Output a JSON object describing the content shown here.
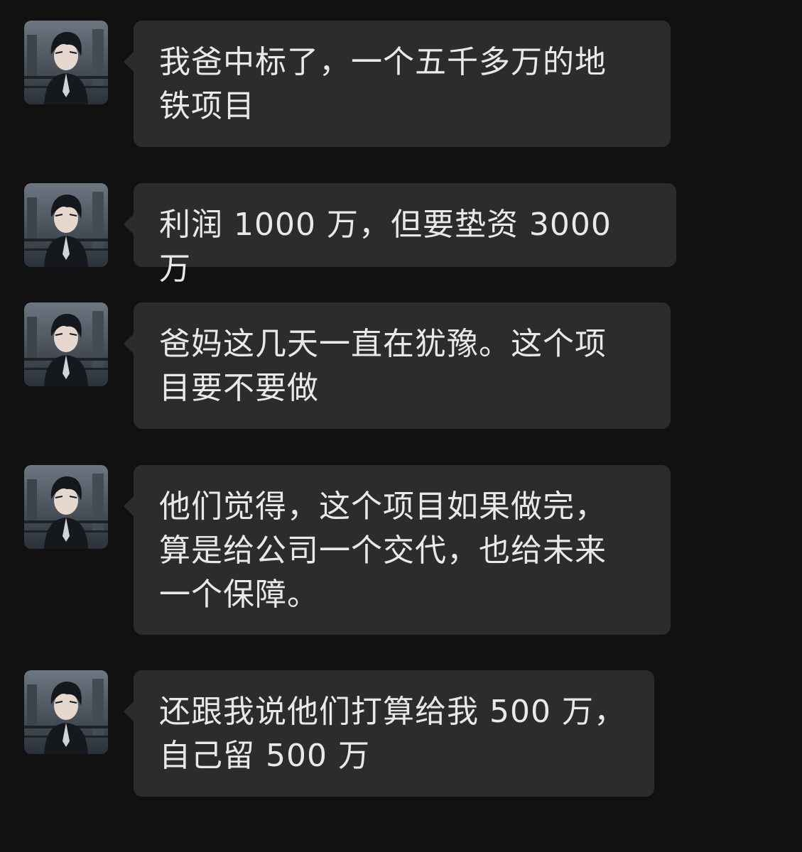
{
  "colors": {
    "background": "#111111",
    "bubble": "#2c2c2c",
    "text": "#e9e9e9"
  },
  "messages": [
    {
      "avatar_icon": "user-avatar-icon",
      "text": "我爸中标了，一个五千多万的地\n铁项目"
    },
    {
      "avatar_icon": "user-avatar-icon",
      "text": "利润 1000 万，但要垫资 3000 万"
    },
    {
      "avatar_icon": "user-avatar-icon",
      "text": "爸妈这几天一直在犹豫。这个项\n目要不要做"
    },
    {
      "avatar_icon": "user-avatar-icon",
      "text": "他们觉得，这个项目如果做完，\n算是给公司一个交代，也给未来\n一个保障。"
    },
    {
      "avatar_icon": "user-avatar-icon",
      "text": "还跟我说他们打算给我 500 万，\n自己留 500 万"
    }
  ]
}
